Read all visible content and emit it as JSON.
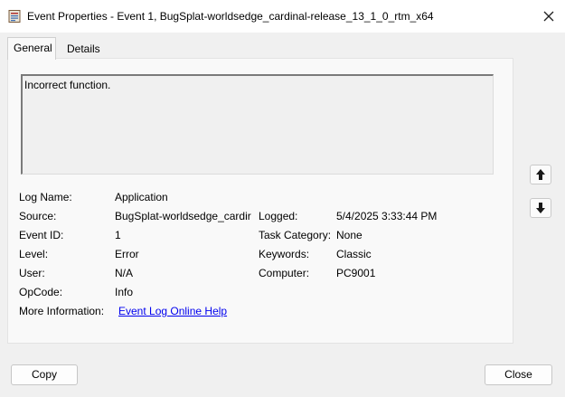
{
  "window": {
    "title": "Event Properties - Event 1, BugSplat-worldsedge_cardinal-release_13_1_0_rtm_x64",
    "close_icon": "close-icon"
  },
  "tabs": [
    {
      "label": "General",
      "active": true
    },
    {
      "label": "Details",
      "active": false
    }
  ],
  "description": "Incorrect function.",
  "fields": {
    "log_name": {
      "label": "Log Name:",
      "value": "Application"
    },
    "source": {
      "label": "Source:",
      "value": "BugSplat-worldsedge_cardir"
    },
    "logged": {
      "label": "Logged:",
      "value": "5/4/2025 3:33:44 PM"
    },
    "event_id": {
      "label": "Event ID:",
      "value": "1"
    },
    "task_category": {
      "label": "Task Category:",
      "value": "None"
    },
    "level": {
      "label": "Level:",
      "value": "Error"
    },
    "keywords": {
      "label": "Keywords:",
      "value": "Classic"
    },
    "user": {
      "label": "User:",
      "value": "N/A"
    },
    "computer": {
      "label": "Computer:",
      "value": "PC9001"
    },
    "opcode": {
      "label": "OpCode:",
      "value": "Info"
    },
    "more_info": {
      "label": "More Information:",
      "value": "Event Log Online Help"
    }
  },
  "side_buttons": {
    "up_icon": "arrow-up-icon",
    "down_icon": "arrow-down-icon"
  },
  "buttons": {
    "copy": "Copy",
    "close": "Close"
  },
  "colors": {
    "link": "#0000ee",
    "background": "#f0f0f0"
  }
}
